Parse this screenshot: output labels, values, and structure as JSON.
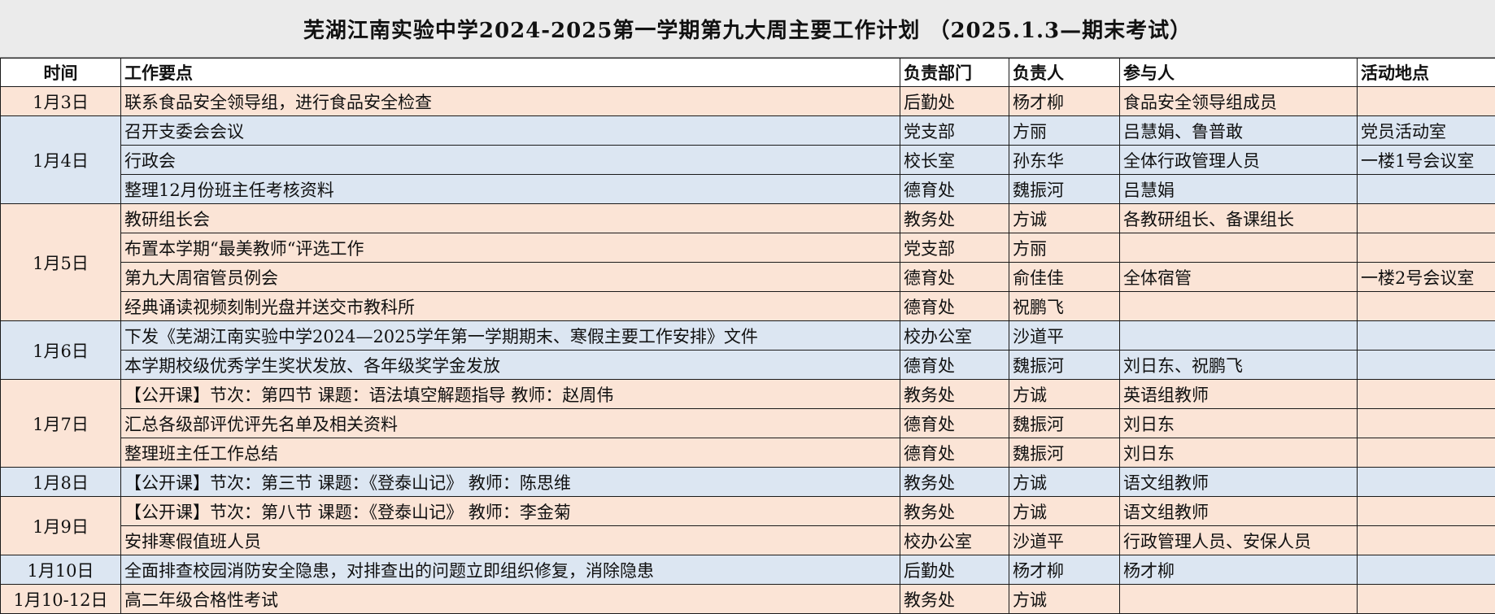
{
  "title": "芜湖江南实验中学2024-2025第一学期第九大周主要工作计划 （2025.1.3—期末考试）",
  "headers": {
    "date": "时间",
    "task": "工作要点",
    "dept": "负责部门",
    "owner": "负责人",
    "participants": "参与人",
    "location": "活动地点"
  },
  "colors": {
    "peach": "#fbe4d6",
    "blue": "#dce6f2",
    "title_bg": "#ebebeb"
  },
  "groups": [
    {
      "date": "1月3日",
      "color": "peach",
      "rows": [
        {
          "task": "联系食品安全领导组，进行食品安全检查",
          "dept": "后勤处",
          "owner": "杨才柳",
          "participants": "食品安全领导组成员",
          "location": ""
        }
      ]
    },
    {
      "date": "1月4日",
      "color": "blue",
      "rows": [
        {
          "task": "召开支委会会议",
          "dept": "党支部",
          "owner": "方丽",
          "participants": "吕慧娟、鲁普敢",
          "location": "党员活动室"
        },
        {
          "task": "行政会",
          "dept": "校长室",
          "owner": "孙东华",
          "participants": "全体行政管理人员",
          "location": "一楼1号会议室"
        },
        {
          "task": "整理12月份班主任考核资料",
          "dept": "德育处",
          "owner": "魏振河",
          "participants": "吕慧娟",
          "location": ""
        }
      ]
    },
    {
      "date": "1月5日",
      "color": "peach",
      "rows": [
        {
          "task": "教研组长会",
          "dept": "教务处",
          "owner": "方诚",
          "participants": "各教研组长、备课组长",
          "location": ""
        },
        {
          "task": "布置本学期“最美教师“评选工作",
          "dept": "党支部",
          "owner": "方丽",
          "participants": "",
          "location": ""
        },
        {
          "task": "第九大周宿管员例会",
          "dept": "德育处",
          "owner": "俞佳佳",
          "participants": "全体宿管",
          "location": "一楼2号会议室"
        },
        {
          "task": "经典诵读视频刻制光盘并送交市教科所",
          "dept": "德育处",
          "owner": "祝鹏飞",
          "participants": "",
          "location": ""
        }
      ]
    },
    {
      "date": "1月6日",
      "color": "blue",
      "rows": [
        {
          "task": "下发《芜湖江南实验中学2024—2025学年第一学期期末、寒假主要工作安排》文件",
          "dept": "校办公室",
          "owner": "沙道平",
          "participants": "",
          "location": ""
        },
        {
          "task": "本学期校级优秀学生奖状发放、各年级奖学金发放",
          "dept": "德育处",
          "owner": "魏振河",
          "participants": "刘日东、祝鹏飞",
          "location": ""
        }
      ]
    },
    {
      "date": "1月7日",
      "color": "peach",
      "rows": [
        {
          "task": "【公开课】节次：第四节 课题：语法填空解题指导 教师：赵周伟",
          "dept": "教务处",
          "owner": "方诚",
          "participants": "英语组教师",
          "location": ""
        },
        {
          "task": "汇总各级部评优评先名单及相关资料",
          "dept": "德育处",
          "owner": "魏振河",
          "participants": "刘日东",
          "location": ""
        },
        {
          "task": "整理班主任工作总结",
          "dept": "德育处",
          "owner": "魏振河",
          "participants": "刘日东",
          "location": ""
        }
      ]
    },
    {
      "date": "1月8日",
      "color": "blue",
      "rows": [
        {
          "task": "【公开课】节次：第三节 课题：《登泰山记》 教师：陈思维",
          "dept": "教务处",
          "owner": "方诚",
          "participants": "语文组教师",
          "location": ""
        }
      ]
    },
    {
      "date": "1月9日",
      "color": "peach",
      "rows": [
        {
          "task": "【公开课】节次：第八节 课题：《登泰山记》 教师：李金菊",
          "dept": "教务处",
          "owner": "方诚",
          "participants": "语文组教师",
          "location": ""
        },
        {
          "task": "安排寒假值班人员",
          "dept": "校办公室",
          "owner": "沙道平",
          "participants": "行政管理人员、安保人员",
          "location": ""
        }
      ]
    },
    {
      "date": "1月10日",
      "color": "blue",
      "rows": [
        {
          "task": "全面排查校园消防安全隐患，对排查出的问题立即组织修复，消除隐患",
          "dept": "后勤处",
          "owner": "杨才柳",
          "participants": "杨才柳",
          "location": ""
        }
      ]
    },
    {
      "date": "1月10-12日",
      "color": "peach",
      "rows": [
        {
          "task": "高二年级合格性考试",
          "dept": "教务处",
          "owner": "方诚",
          "participants": "",
          "location": ""
        }
      ]
    }
  ]
}
